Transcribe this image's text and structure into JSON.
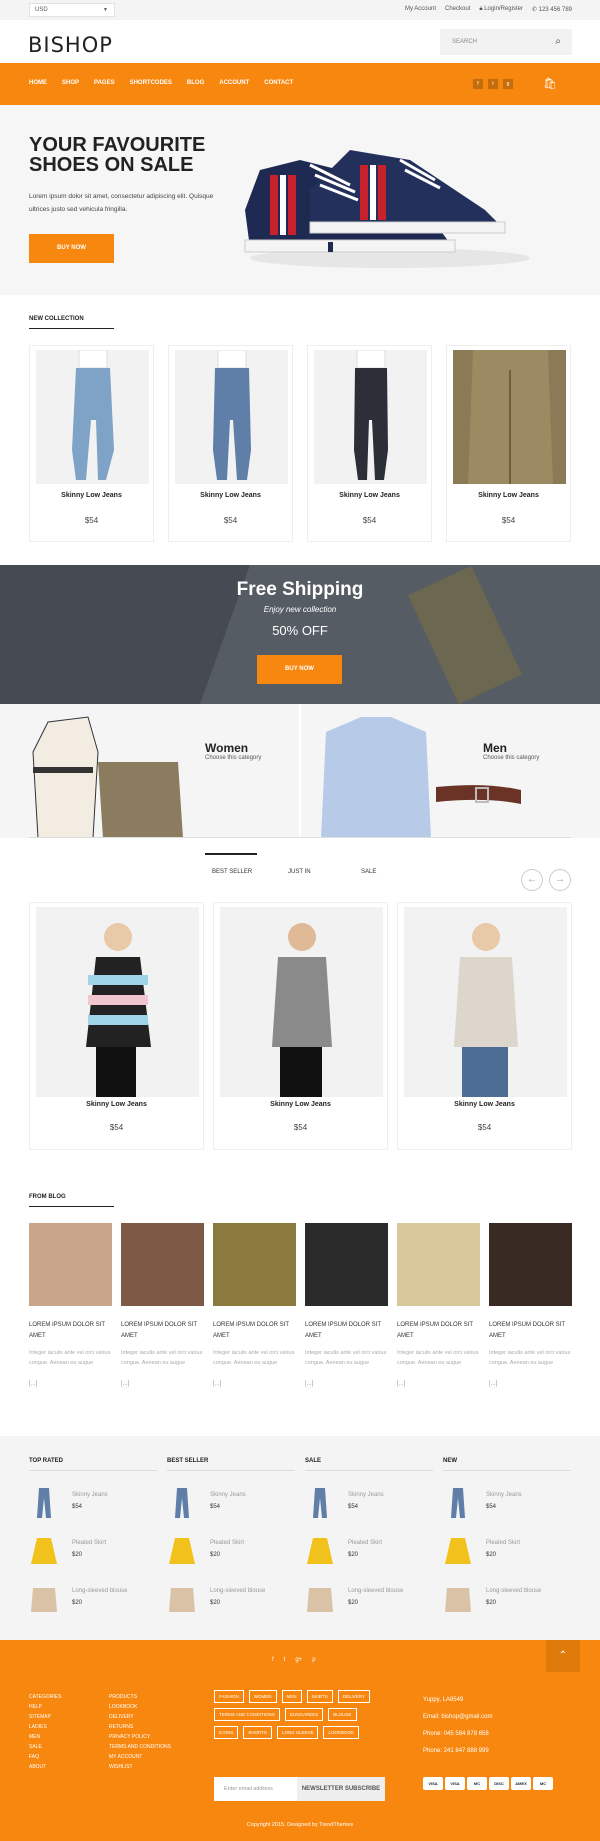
{
  "topbar": {
    "currency": "USD",
    "links": [
      "My Account",
      "Checkout",
      "Login/Register"
    ],
    "phone": "123 456 789"
  },
  "header": {
    "logo": "BISHOP",
    "search_placeholder": "SEARCH"
  },
  "nav": {
    "items": [
      "HOME",
      "SHOP",
      "PAGES",
      "SHORTCODES",
      "BLOG",
      "ACCOUNT",
      "CONTACT"
    ],
    "social": [
      "f",
      "t",
      "g"
    ]
  },
  "hero": {
    "title": "YOUR FAVOURITE SHOES ON SALE",
    "text": "Lorem ipsum dolor sit amet, consectetur adipiscing elit. Quisque ultrices justo sed vehicula fringilla.",
    "button": "BUY NOW"
  },
  "new_collection": {
    "title": "NEW COLLECTION",
    "items": [
      {
        "name": "Skinny Low Jeans",
        "price": "$54"
      },
      {
        "name": "Skinny Low Jeans",
        "price": "$54"
      },
      {
        "name": "Skinny Low Jeans",
        "price": "$54"
      },
      {
        "name": "Skinny Low Jeans",
        "price": "$54"
      }
    ]
  },
  "banner": {
    "title": "Free Shipping",
    "subtitle": "Enjoy new collection",
    "offer": "50% OFF",
    "button": "BUY NOW"
  },
  "categories": [
    {
      "title": "Women",
      "sub": "Choose this category"
    },
    {
      "title": "Men",
      "sub": "Choose this category"
    }
  ],
  "tabs": {
    "labels": [
      "BEST SELLER",
      "JUST IN",
      "SALE"
    ],
    "items": [
      {
        "name": "Skinny Low Jeans",
        "price": "$54"
      },
      {
        "name": "Skinny Low Jeans",
        "price": "$54"
      },
      {
        "name": "Skinny Low Jeans",
        "price": "$54"
      }
    ]
  },
  "blog": {
    "title": "FROM BLOG",
    "posts": [
      {
        "title": "LOREM IPSUM DOLOR SIT AMET",
        "text": "Integer iaculis ante vel orci varius congue. Aenean eu augue",
        "more": "[...]"
      },
      {
        "title": "LOREM IPSUM DOLOR SIT AMET",
        "text": "Integer iaculis ante vel orci varius congue. Aenean eu augue",
        "more": "[...]"
      },
      {
        "title": "LOREM IPSUM DOLOR SIT AMET",
        "text": "Integer iaculis ante vel orci varius congue. Aenean eu augue",
        "more": "[...]"
      },
      {
        "title": "LOREM IPSUM DOLOR SIT AMET",
        "text": "Integer iaculis ante vel orci varius congue. Aenean eu augue",
        "more": "[...]"
      },
      {
        "title": "LOREM IPSUM DOLOR SIT AMET",
        "text": "Integer iaculis ante vel orci varius congue. Aenean eu augue",
        "more": "[...]"
      },
      {
        "title": "LOREM IPSUM DOLOR SIT AMET",
        "text": "Integer iaculis ante vel orci varius congue. Aenean eu augue",
        "more": "[...]"
      }
    ]
  },
  "lists": [
    {
      "title": "TOP RATED",
      "items": [
        {
          "name": "Skinny Jeans",
          "price": "$54"
        },
        {
          "name": "Pleated Skirt",
          "price": "$20"
        },
        {
          "name": "Long-sleeved blouse",
          "price": "$20"
        }
      ]
    },
    {
      "title": "BEST SELLER",
      "items": [
        {
          "name": "Skinny Jeans",
          "price": "$54"
        },
        {
          "name": "Pleated Skirt",
          "price": "$20"
        },
        {
          "name": "Long-sleeved blouse",
          "price": "$20"
        }
      ]
    },
    {
      "title": "SALE",
      "items": [
        {
          "name": "Skinny Jeans",
          "price": "$54"
        },
        {
          "name": "Pleated Skirt",
          "price": "$20"
        },
        {
          "name": "Long-sleeved blouse",
          "price": "$20"
        }
      ]
    },
    {
      "title": "NEW",
      "items": [
        {
          "name": "Skinny Jeans",
          "price": "$54"
        },
        {
          "name": "Pleated Skirt",
          "price": "$20"
        },
        {
          "name": "Long-sleeved blouse",
          "price": "$20"
        }
      ]
    }
  ],
  "footer": {
    "social": [
      "f",
      "t",
      "g+",
      "p"
    ],
    "col1": [
      "CATEGORIES",
      "HELP",
      "SITEMAP",
      "LADIES",
      "MEN",
      "SALE",
      "FAQ",
      "ABOUT"
    ],
    "col2": [
      "PRODUCTS",
      "LOOKBOOK",
      "DELIVERY",
      "RETURNS",
      "PRIVACY POLICY",
      "TERMS AND CONDITIONS",
      "MY ACCOUNT",
      "WISHLIST"
    ],
    "tags": [
      "FASHION",
      "WOMEN",
      "MEN",
      "SKIRTS",
      "DELIVERY",
      "TERMS AND CONDITIONS",
      "DUNGAREES",
      "BLOUSE",
      "ICONS",
      "SHORTS",
      "LONG SLEEVE",
      "LOOKBOOK"
    ],
    "contact": [
      "Yuppy, LA8549",
      "Email: bishop@gmail.com",
      "Phone: 045 584 878 658",
      "Phone: 241 847 888 999"
    ],
    "newsletter_placeholder": "Enter email address",
    "newsletter_button": "NEWSLETTER SUBSCRIBE",
    "payments": [
      "VISA",
      "VISA",
      "MC",
      "DISC",
      "AMEX",
      "MC"
    ],
    "copyright": "Copyright 2015. Designed by TrendThemes"
  },
  "colors": {
    "accent": "#f7870e"
  }
}
